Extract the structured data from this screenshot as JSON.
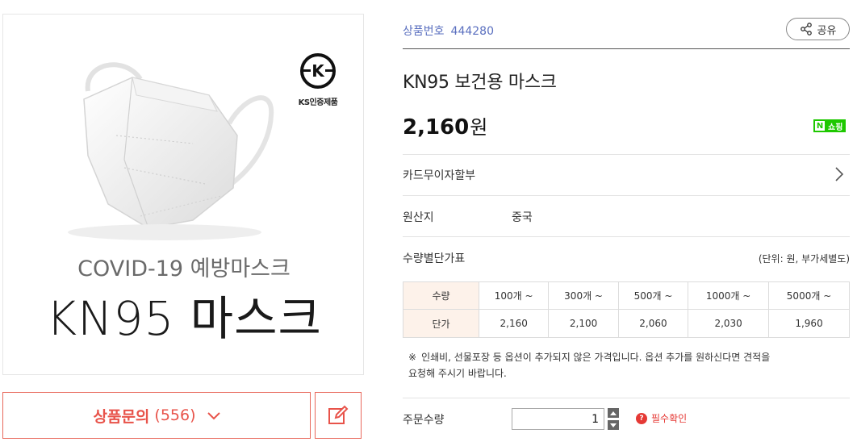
{
  "image": {
    "brand_badge": "KS인증제품",
    "headline": "COVID-19 예방마스크",
    "product_text": "KN95 마스크"
  },
  "inquiry": {
    "label": "상품문의",
    "count": "(556)"
  },
  "product": {
    "number_label": "상품번호",
    "number": "444280",
    "share_label": "공유",
    "title": "KN95 보건용 마스크",
    "price": "2,160",
    "currency": "원",
    "npay_label": "쇼핑",
    "npay_letter": "N"
  },
  "details": {
    "card_installment": "카드무이자할부",
    "origin_label": "원산지",
    "origin_value": "중국",
    "qty_table_label": "수량별단가표",
    "unit_note": "(단위: 원, 부가세별도)"
  },
  "qty_table": {
    "row1_head": "수량",
    "row2_head": "단가",
    "tiers": [
      "100개 ~",
      "300개 ~",
      "500개 ~",
      "1000개 ~",
      "5000개 ~"
    ],
    "prices": [
      "2,160",
      "2,100",
      "2,060",
      "2,030",
      "1,960"
    ]
  },
  "notice": {
    "mark": "※",
    "line1": "인쇄비, 선물포장 등 옵션이 추가되지 않은 가격입니다.   옵션 추가를 원하신다면 견적을",
    "line2": "요청해 주시기 바랍니다."
  },
  "order": {
    "label": "주문수량",
    "quantity": "1",
    "required_label": "필수확인",
    "required_icon": "?"
  },
  "colors": {
    "accent": "#e8534a",
    "link_blue": "#5a6fbf",
    "table_head_bg": "#fdf2ea",
    "npay_green": "#1ec800"
  }
}
